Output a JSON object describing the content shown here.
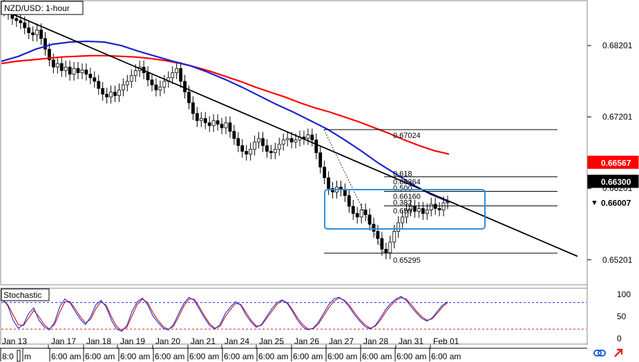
{
  "chart_data": {
    "type": "candlestick",
    "title": "NZD/USD: 1-hour",
    "price_axis": {
      "min": 0.649,
      "max": 0.688,
      "tick_labels": [
        "0.68201",
        "0.67201",
        "0.66201",
        "0.65201"
      ],
      "tick_values": [
        0.68201,
        0.67201,
        0.66201,
        0.65201
      ]
    },
    "price_tags": [
      {
        "value": 0.66567,
        "label": "0.66567",
        "color": "#ff0000",
        "text_color": "#ffffff"
      },
      {
        "value": 0.663,
        "label": "0.66300",
        "color": "#000000",
        "text_color": "#ffffff"
      },
      {
        "value": 0.66007,
        "label": "0.66007",
        "color": "#ffffff",
        "text_color": "#000000",
        "marker": "▼"
      }
    ],
    "date_labels": [
      "Jan 13",
      "Jan 17",
      "Jan 18",
      "Jan 19",
      "Jan 20",
      "Jan 21",
      "Jan 24",
      "Jan 25",
      "Jan 26",
      "Jan 27",
      "Jan 28",
      "Jan 31",
      "Feb 01"
    ],
    "time_labels": [
      "8:0",
      "m",
      "6:00 am",
      "6:00 am",
      "6:00 am",
      "6:00 am",
      "6:00 am",
      "6:00 am",
      "6:00 am",
      "6:00 am",
      "6:00 am",
      "6:00 am",
      "6:00 am",
      "6:00 am"
    ],
    "fibonacci": {
      "high": 0.67024,
      "low": 0.65295,
      "levels": [
        {
          "ratio": "0.67024",
          "value": 0.67024
        },
        {
          "ratio": "0.618",
          "value": 0.66364
        },
        {
          "ratio": "0.66364",
          "value": 0.66364
        },
        {
          "ratio": "0.500",
          "value": 0.6616
        },
        {
          "ratio": "0.66160",
          "value": 0.6616
        },
        {
          "ratio": "0.382",
          "value": 0.65956
        },
        {
          "ratio": "0.659",
          "value": 0.65956
        },
        {
          "ratio": "0.65295",
          "value": 0.65295
        }
      ]
    },
    "close_series": [
      0.687,
      0.6865,
      0.6858,
      0.6855,
      0.6852,
      0.6845,
      0.6838,
      0.6835,
      0.6842,
      0.683,
      0.6815,
      0.68,
      0.679,
      0.6795,
      0.6785,
      0.679,
      0.678,
      0.6788,
      0.6782,
      0.6786,
      0.678,
      0.6775,
      0.677,
      0.676,
      0.6752,
      0.6748,
      0.6755,
      0.675,
      0.6758,
      0.6765,
      0.677,
      0.6778,
      0.6785,
      0.679,
      0.6782,
      0.6772,
      0.6765,
      0.6758,
      0.6762,
      0.677,
      0.6775,
      0.6782,
      0.6788,
      0.677,
      0.6755,
      0.674,
      0.6725,
      0.6715,
      0.6718,
      0.6712,
      0.6708,
      0.6715,
      0.671,
      0.6705,
      0.6712,
      0.67,
      0.669,
      0.668,
      0.6672,
      0.6668,
      0.6675,
      0.6685,
      0.669,
      0.668,
      0.6672,
      0.667,
      0.6675,
      0.6682,
      0.6688,
      0.669,
      0.6685,
      0.6688,
      0.6692,
      0.669,
      0.6695,
      0.6688,
      0.667,
      0.665,
      0.6635,
      0.662,
      0.6615,
      0.6622,
      0.6618,
      0.661,
      0.6595,
      0.6585,
      0.658,
      0.659,
      0.6583,
      0.657,
      0.656,
      0.655,
      0.6535,
      0.653,
      0.6545,
      0.656,
      0.6572,
      0.658,
      0.659,
      0.6595,
      0.6588,
      0.6592,
      0.6585,
      0.659,
      0.6598,
      0.6592,
      0.659,
      0.66,
      0.6601
    ],
    "ma_red": [
      0.6795,
      0.6798,
      0.68,
      0.6802,
      0.6804,
      0.6805,
      0.6806,
      0.6806,
      0.6805,
      0.6804,
      0.6802,
      0.6799,
      0.6795,
      0.679,
      0.6784,
      0.6777,
      0.677,
      0.6762,
      0.6755,
      0.6748,
      0.674,
      0.6733,
      0.6727,
      0.672,
      0.6713,
      0.6705,
      0.6697,
      0.6688,
      0.668,
      0.6673,
      0.6668
    ],
    "ma_blue": [
      0.6798,
      0.6805,
      0.6815,
      0.6822,
      0.6825,
      0.6826,
      0.6825,
      0.682,
      0.6812,
      0.6805,
      0.6798,
      0.6792,
      0.6783,
      0.6773,
      0.6762,
      0.675,
      0.6738,
      0.6727,
      0.6715,
      0.6703,
      0.6688,
      0.6672,
      0.6655,
      0.664,
      0.6625,
      0.6612,
      0.6602
    ],
    "trendline": {
      "from": 0.687,
      "to": 0.6525
    },
    "stochastic": {
      "label": "Stochastic",
      "levels": [
        "100",
        "50",
        "0"
      ],
      "upper": 80,
      "lower": 20,
      "k": [
        88,
        72,
        40,
        22,
        30,
        55,
        68,
        40,
        25,
        18,
        35,
        70,
        88,
        80,
        60,
        42,
        30,
        48,
        75,
        85,
        70,
        40,
        20,
        15,
        28,
        60,
        82,
        90,
        75,
        50,
        35,
        22,
        18,
        30,
        55,
        78,
        92,
        85,
        65,
        45,
        28,
        20,
        30,
        55,
        70,
        82,
        74,
        52,
        36,
        24,
        30,
        48,
        66,
        80,
        86,
        78,
        60,
        40,
        25,
        18,
        22,
        35,
        55,
        75,
        88,
        92,
        84,
        70,
        52,
        38,
        26,
        20,
        28,
        45,
        64,
        78,
        88,
        94,
        85,
        70,
        56,
        44,
        38,
        45,
        60,
        74,
        82
      ],
      "d": [
        84,
        75,
        52,
        30,
        28,
        45,
        62,
        48,
        30,
        20,
        30,
        58,
        82,
        82,
        66,
        48,
        34,
        42,
        66,
        82,
        74,
        48,
        26,
        17,
        24,
        50,
        76,
        88,
        80,
        58,
        40,
        26,
        19,
        26,
        48,
        72,
        88,
        88,
        70,
        50,
        32,
        22,
        26,
        48,
        64,
        78,
        76,
        58,
        40,
        27,
        28,
        44,
        60,
        76,
        84,
        80,
        64,
        45,
        30,
        20,
        21,
        31,
        49,
        68,
        83,
        90,
        86,
        74,
        57,
        42,
        30,
        22,
        26,
        40,
        58,
        73,
        85,
        91,
        88,
        75,
        60,
        48,
        40,
        43,
        56,
        70,
        80
      ]
    }
  }
}
